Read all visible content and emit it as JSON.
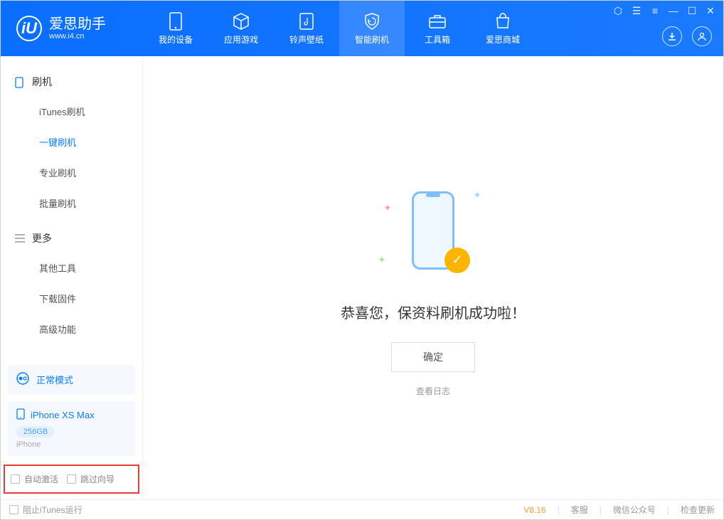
{
  "app": {
    "title": "爱思助手",
    "subtitle": "www.i4.cn",
    "logo_letter": "iU"
  },
  "nav": {
    "items": [
      {
        "label": "我的设备",
        "icon": "device"
      },
      {
        "label": "应用游戏",
        "icon": "cube"
      },
      {
        "label": "铃声壁纸",
        "icon": "music"
      },
      {
        "label": "智能刷机",
        "icon": "shield",
        "active": true
      },
      {
        "label": "工具箱",
        "icon": "toolbox"
      },
      {
        "label": "爱思商城",
        "icon": "bag"
      }
    ]
  },
  "sidebar": {
    "group1_label": "刷机",
    "items1": [
      {
        "label": "iTunes刷机"
      },
      {
        "label": "一键刷机",
        "active": true
      },
      {
        "label": "专业刷机"
      },
      {
        "label": "批量刷机"
      }
    ],
    "group2_label": "更多",
    "items2": [
      {
        "label": "其他工具"
      },
      {
        "label": "下载固件"
      },
      {
        "label": "高级功能"
      }
    ],
    "status": "正常模式",
    "device": {
      "name": "iPhone XS Max",
      "capacity": "256GB",
      "type": "iPhone"
    },
    "options": {
      "auto_activate": "自动激活",
      "skip_guide": "跳过向导"
    }
  },
  "content": {
    "message": "恭喜您，保资料刷机成功啦！",
    "confirm": "确定",
    "log_link": "查看日志"
  },
  "footer": {
    "block_itunes": "阻止iTunes运行",
    "version": "V8.16",
    "support": "客服",
    "wechat": "微信公众号",
    "update": "检查更新"
  }
}
